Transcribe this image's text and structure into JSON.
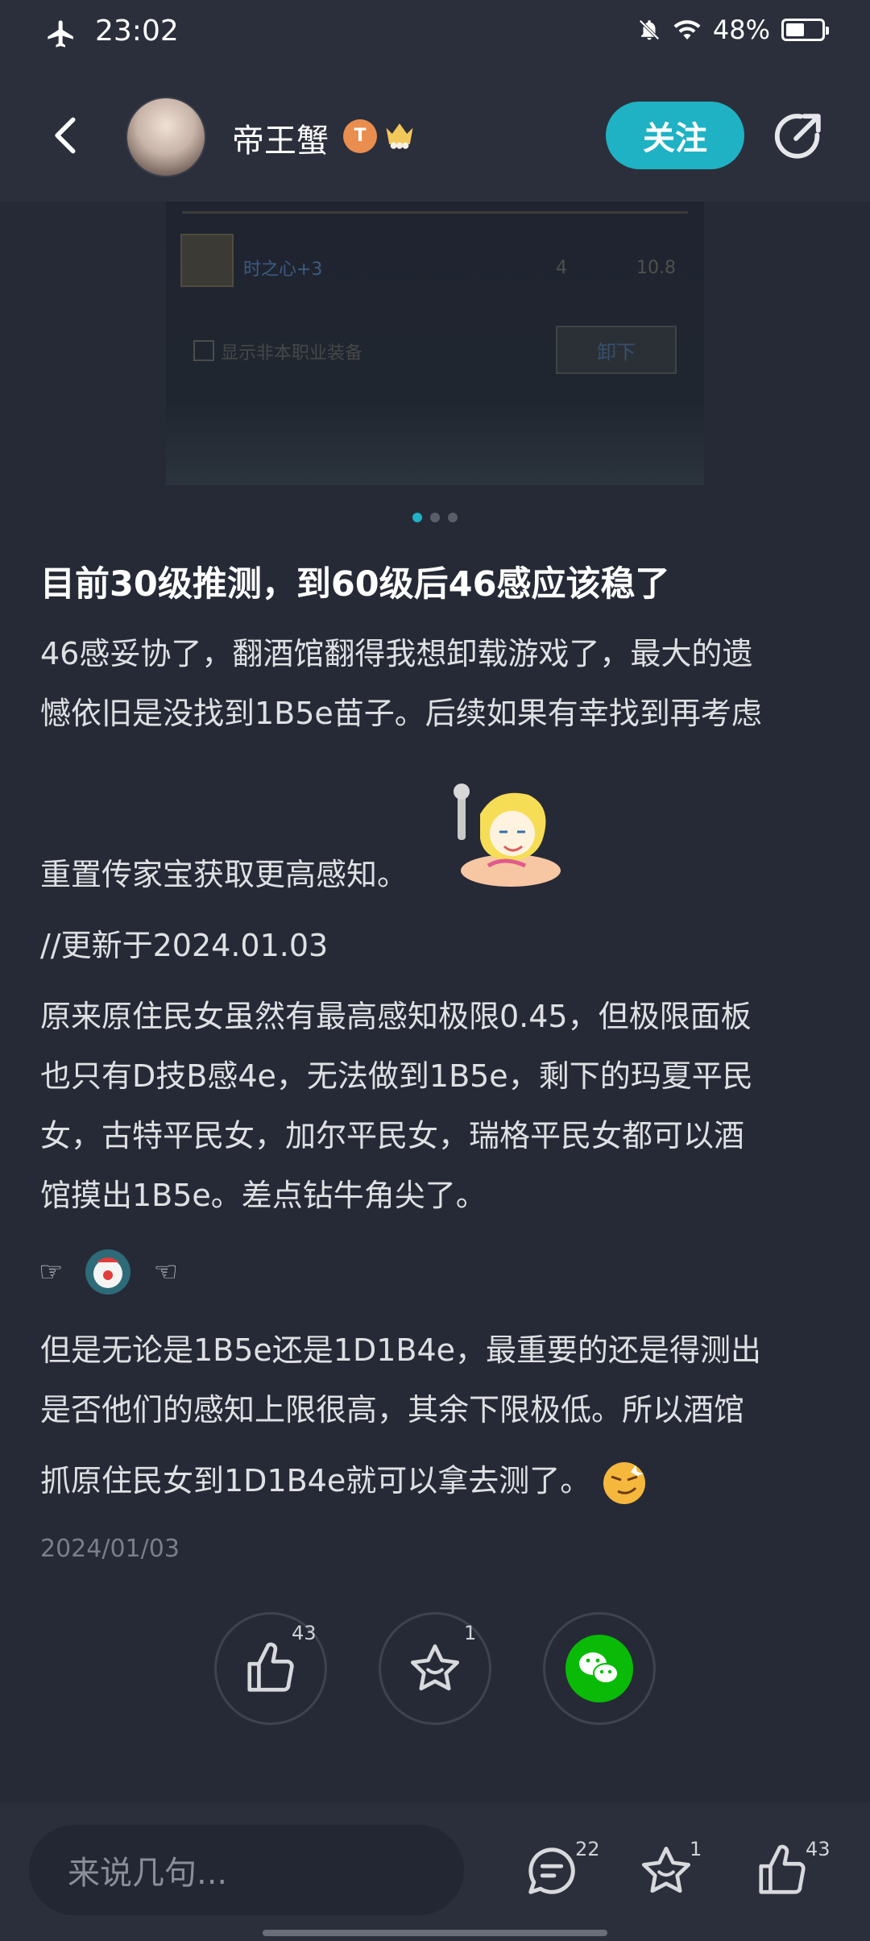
{
  "status_bar": {
    "time": "23:02",
    "battery": "48%"
  },
  "header": {
    "username": "帝王蟹",
    "badge": "T",
    "follow_label": "关注"
  },
  "image_content": {
    "item_name": "时之心+3",
    "col1": "4",
    "col2": "10.8",
    "checkbox_label": "显示非本职业装备",
    "unequip_label": "卸下"
  },
  "carousel": {
    "count": 3,
    "active": 0
  },
  "post": {
    "title": "目前30级推测，到60级后46感应该稳了",
    "p1_line1": "46感妥协了，翻酒馆翻得我想卸载游戏了，最大的遗",
    "p1_line2": "憾依旧是没找到1B5e苗子。后续如果有幸找到再考虑",
    "p1_line3": "重置传家宝获取更高感知。",
    "p2": "//更新于2024.01.03",
    "p3_line1": "原来原住民女虽然有最高感知极限0.45，但极限面板",
    "p3_line2": "也只有D技B感4e，无法做到1B5e，剩下的玛夏平民",
    "p3_line3": "女，古特平民女，加尔平民女，瑞格平民女都可以酒",
    "p3_line4": "馆摸出1B5e。差点钻牛角尖了。",
    "pointer_left": "☞",
    "pointer_right": "☜",
    "p4_line1": "但是无论是1B5e还是1D1B4e，最重要的还是得测出",
    "p4_line2": "是否他们的感知上限很高，其余下限极低。所以酒馆",
    "p4_line3": "抓原住民女到1D1B4e就可以拿去测了。",
    "date": "2024/01/03"
  },
  "actions": {
    "like_count": "43",
    "favorite_count": "1"
  },
  "bottom_bar": {
    "comment_placeholder": "来说几句...",
    "comment_count": "22",
    "favorite_count": "1",
    "like_count": "43"
  },
  "colors": {
    "accent": "#1fb2c4",
    "background": "#262a36",
    "wechat": "#09bb07"
  }
}
